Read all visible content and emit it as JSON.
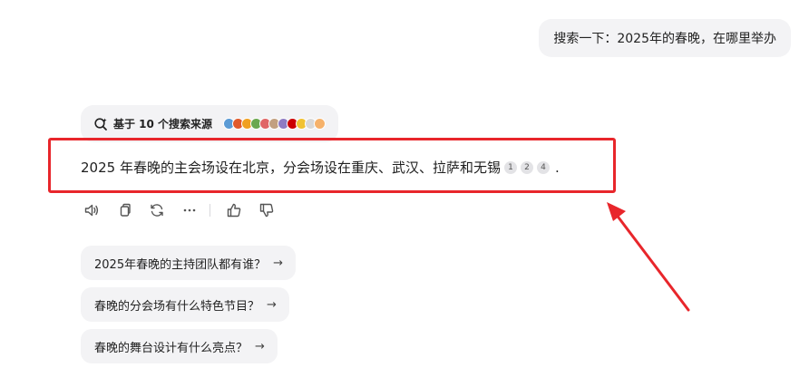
{
  "user_message": "搜索一下：2025年的春晚，在哪里举办",
  "sources": {
    "label": "基于 10 个搜索来源",
    "favicon_colors": [
      "#5b9bd5",
      "#e05a2b",
      "#f0a020",
      "#6aa84f",
      "#e06666",
      "#c2a080",
      "#8e7cc3",
      "#cc0000",
      "#f1c232",
      "#d9d9d9",
      "#f6b26b"
    ]
  },
  "answer": {
    "text": "2025 年春晚的主会场设在北京，分会场设在重庆、武汉、拉萨和无锡",
    "citations": [
      "1",
      "2",
      "4"
    ],
    "end": "."
  },
  "actions": [
    "speaker-icon",
    "copy-icon",
    "regenerate-icon",
    "more-icon",
    "thumbs-up-icon",
    "thumbs-down-icon"
  ],
  "suggestions": [
    {
      "label": "2025年春晚的主持团队都有谁？",
      "arrow": "→"
    },
    {
      "label": "春晚的分会场有什么特色节目？",
      "arrow": "→"
    },
    {
      "label": "春晚的舞台设计有什么亮点？",
      "arrow": "→"
    }
  ],
  "colors": {
    "annotation_red": "#e8262b",
    "bubble_bg": "#f3f3f5"
  }
}
